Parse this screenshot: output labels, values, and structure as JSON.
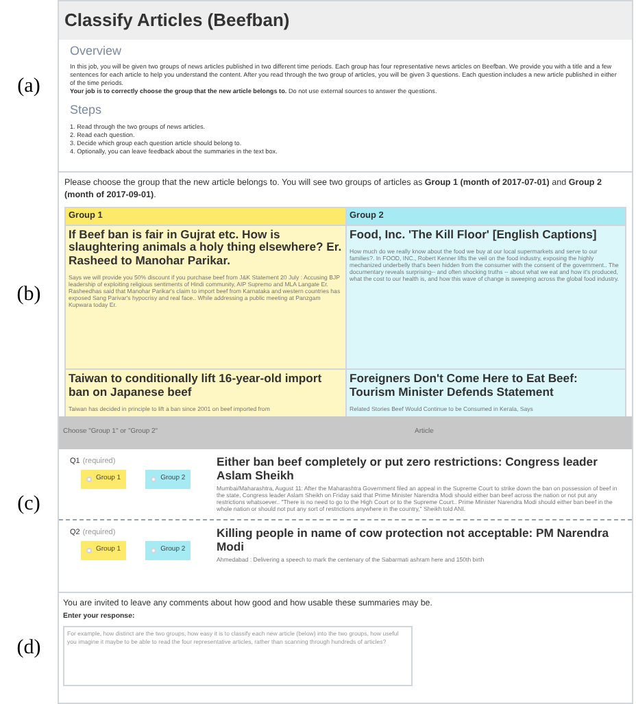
{
  "page": {
    "title": "Classify Articles (Beefban)",
    "overview": {
      "heading": "Overview",
      "paragraph": "In this job, you will be given two groups of news articles published in two different time periods. Each group has four representative news articles on Beefban. We provide you with a title and a few sentences for each article to help you understand the content. After you read through the two group of articles, you will be given 3 questions. Each question includes a new article published in either of the time periods.",
      "instruction": "**Your job is to correctly choose the group that the new article belongs to.** Do not use external sources to answer the questions."
    },
    "steps": {
      "heading": "Steps",
      "items": [
        "1. Read through the two groups of news articles.",
        "2. Read each question.",
        "3. Decide which group each question article should belong to.",
        "4. Optionally, you can leave feedback about the summaries in the text box."
      ]
    }
  },
  "groups_section": {
    "instruction": "Please choose the group that the new article belongs to. You will see two groups of articles as **Group 1 (month of 2017-07-01)** and **Group 2 (month of 2017-09-01)**.",
    "groups": [
      {
        "header": "Group 1",
        "color": "#fde96a",
        "articles": [
          {
            "title": "If Beef ban is fair in Gujrat etc. How is slaughtering animals a holy thing elsewhere? Er. Rasheed to Manohar Parikar.",
            "body": "Says we will provide you 50% discount if you purchase beef from J&K Statement 20 July : Accusing BJP leadership of exploiting religious sentiments of Hindi community, AIP Supremo and MLA Langate Er. Rasheedhas said that Manohar Parikar's claim to import beef from Karnataka and western countries has exposed Sang Parivar's hypocrisy and real face.. While addressing a public meeting at Panzgam Kupwara today Er."
          },
          {
            "title": "Taiwan to conditionally lift 16-year-old import ban on Japanese beef",
            "body": "Taiwan has decided in principle to lift a ban since 2001 on beef imported from"
          }
        ]
      },
      {
        "header": "Group 2",
        "color": "#a6ebf3",
        "articles": [
          {
            "title": "Food, Inc. 'The Kill Floor' [English Captions]",
            "body": "How much do we really know about the food we buy at our local supermarkets and serve to our families?. In FOOD, INC., Robert Kenner lifts the veil on the food industry, exposing the highly mechanized underbelly that's been hidden from the consumer with the consent of the government.. The documentary reveals surprising-- and often shocking truths -- about what we eat and how it's produced, what the cost to our health is, and how this wave of change is sweeping across the global food industry."
          },
          {
            "title": "Foreigners Don't Come Here to Eat Beef: Tourism Minister Defends Statement",
            "body": "Related Stories Beef Would Continue to be Consumed in Kerala, Says"
          }
        ]
      }
    ]
  },
  "questions_table": {
    "columns": [
      "Choose \"Group 1\" or \"Group 2\"",
      "Article"
    ],
    "questions": [
      {
        "number": "Q1",
        "required": "(required)",
        "options": [
          {
            "label": "Group 1",
            "selected": false
          },
          {
            "label": "Group 2",
            "selected": false
          }
        ],
        "title": "Either ban beef completely or put zero restrictions: Congress leader Aslam Sheikh",
        "body": "Mumbai/Maharashtra, August 11: After the Maharashtra Government filed an appeal in the Supreme Court to strike down the ban on possession of beef in the state, Congress leader Aslam Sheikh on Friday said that Prime Minister Narendra Modi should either ban beef across the nation or not put any restrictions whatsoever.. \"There is no need to go to the High Court or to the Supreme Court.. Prime Minister Narendra Modi should either ban beef in the whole nation or should not put any sort of restrictions anywhere in the country,\" Sheikh told ANI."
      },
      {
        "number": "Q2",
        "required": "(required)",
        "options": [
          {
            "label": "Group 1",
            "selected": false
          },
          {
            "label": "Group 2",
            "selected": false
          }
        ],
        "title": "Killing people in name of cow protection not acceptable: PM Narendra Modi",
        "body": "Ahmedabad : Delivering a speech to mark the centenary of the Sabarmati ashram here and 150th birth"
      }
    ]
  },
  "feedback": {
    "prompt": "You are invited to leave any comments about how good and how usable these summaries may be.",
    "label": "Enter your response:",
    "placeholder": "For example, how distinct are the two groups, how easy it is to classify each new article (below) into the two groups, how useful you imagine it maybe to be able to read the four representative articles, rather than scanning through hundreds of articles?"
  },
  "panel_labels": [
    "(a)",
    "(b)",
    "(c)",
    "(d)"
  ]
}
